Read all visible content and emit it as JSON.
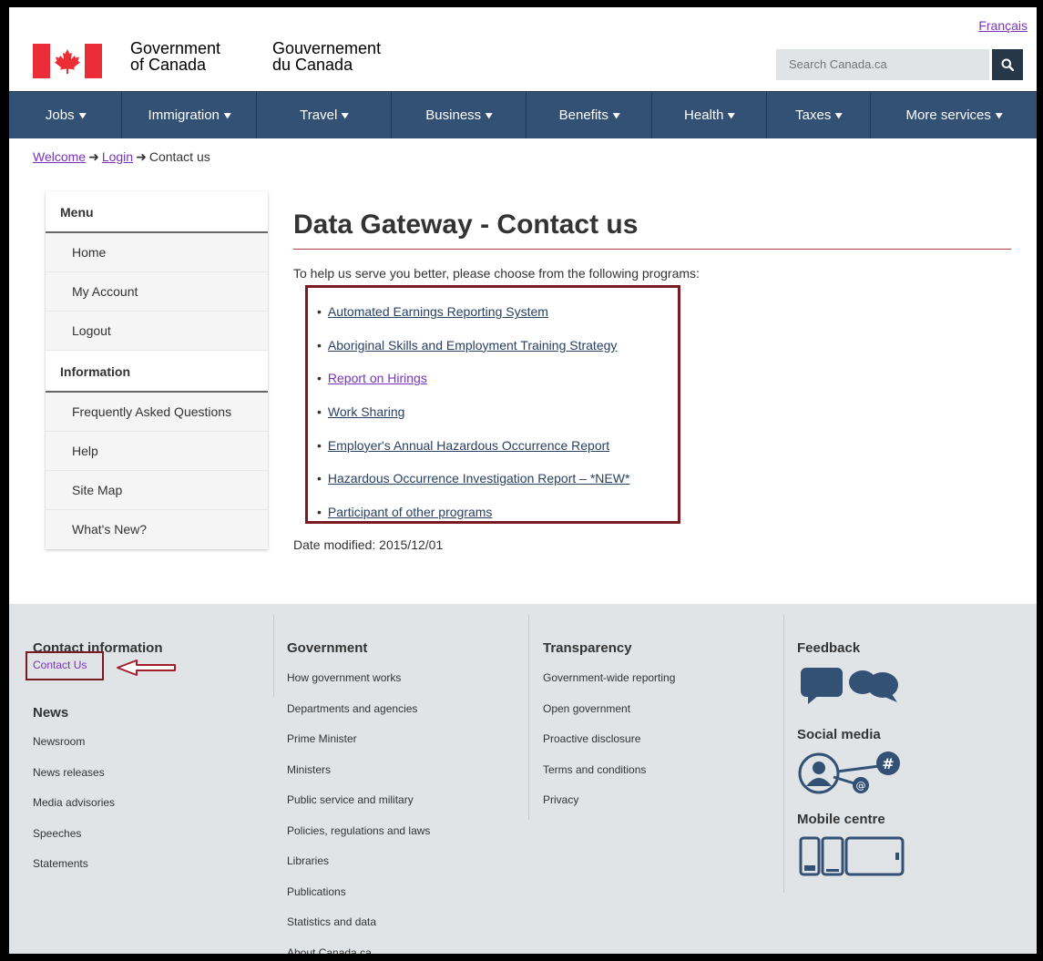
{
  "header": {
    "language_link": "Français",
    "wordmark_en": [
      "Government",
      "of Canada"
    ],
    "wordmark_fr": [
      "Gouvernement",
      "du Canada"
    ],
    "search_placeholder": "Search Canada.ca",
    "search_icon": "search-icon",
    "flag_colors": {
      "red": "#eb2d37",
      "white": "#ffffff"
    }
  },
  "nav": {
    "items": [
      {
        "label": "Jobs"
      },
      {
        "label": "Immigration"
      },
      {
        "label": "Travel"
      },
      {
        "label": "Business"
      },
      {
        "label": "Benefits"
      },
      {
        "label": "Health"
      },
      {
        "label": "Taxes"
      },
      {
        "label": "More services"
      }
    ],
    "chevron": "▾",
    "bg_color": "#335075"
  },
  "breadcrumb": {
    "items": [
      "Welcome",
      "Login",
      "Contact us"
    ],
    "separator": "➜"
  },
  "sidebar": {
    "menu_heading": "Menu",
    "menu_items": [
      "Home",
      "My Account",
      "Logout"
    ],
    "info_heading": "Information",
    "info_items": [
      "Frequently Asked Questions",
      "Help",
      "Site Map",
      "What's New?"
    ]
  },
  "main": {
    "title": "Data Gateway - Contact us",
    "intro": "To help us serve you better, please choose from the following programs:",
    "programs": [
      "Automated Earnings Reporting System",
      "Aboriginal Skills and Employment Training Strategy",
      "Report on Hirings",
      "Work Sharing",
      "Employer's Annual Hazardous Occurrence Report",
      "Hazardous Occurrence Investigation Report – *NEW*",
      "Participant of other programs"
    ],
    "bullet": "•",
    "date_modified": "Date modified: 2015/12/01"
  },
  "footer": {
    "contact_heading": "Contact information",
    "contact_link": "Contact Us",
    "news_heading": "News",
    "news_links": [
      "Newsroom",
      "News releases",
      "Media advisories",
      "Speeches",
      "Statements"
    ],
    "government_heading": "Government",
    "government_links": [
      "How government works",
      "Departments and agencies",
      "Prime Minister",
      "Ministers",
      "Public service and military",
      "Policies, regulations and laws",
      "Libraries",
      "Publications",
      "Statistics and data",
      "About Canada.ca"
    ],
    "transparency_heading": "Transparency",
    "transparency_links": [
      "Government-wide reporting",
      "Open government",
      "Proactive disclosure",
      "Terms and conditions",
      "Privacy"
    ],
    "feedback_heading": "Feedback",
    "social_heading": "Social media",
    "mobile_heading": "Mobile centre",
    "icon_color": "#335075",
    "highlight_color": "#7a1a22"
  }
}
